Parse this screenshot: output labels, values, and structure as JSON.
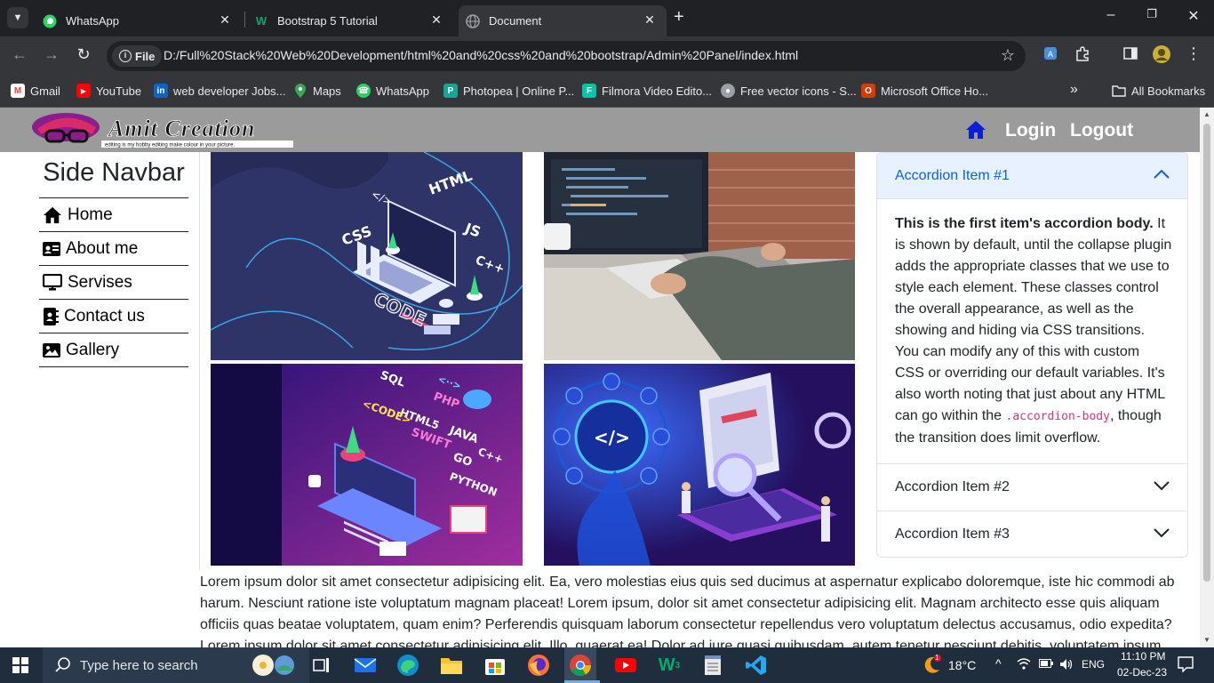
{
  "browser": {
    "tabs": [
      {
        "title": "WhatsApp",
        "active": false
      },
      {
        "title": "Bootstrap 5 Tutorial",
        "active": false
      },
      {
        "title": "Document",
        "active": true
      }
    ],
    "address": {
      "scheme_label": "File",
      "url": "D:/Full%20Stack%20Web%20Development/html%20and%20css%20and%20bootstrap/Admin%20Panel/index.html"
    },
    "bookmarks": [
      {
        "label": "Gmail",
        "icon": "gmail-icon",
        "color": "#ea4335"
      },
      {
        "label": "YouTube",
        "icon": "youtube-icon",
        "color": "#ff0000"
      },
      {
        "label": "web developer Jobs...",
        "icon": "linkedin-icon",
        "color": "#0a66c2"
      },
      {
        "label": "Maps",
        "icon": "maps-icon",
        "color": "#34a853"
      },
      {
        "label": "WhatsApp",
        "icon": "whatsapp-icon",
        "color": "#25d366"
      },
      {
        "label": "Photopea | Online P...",
        "icon": "photopea-icon",
        "color": "#18a497"
      },
      {
        "label": "Filmora Video Edito...",
        "icon": "filmora-icon",
        "color": "#00c6a7"
      },
      {
        "label": "Free vector icons - S...",
        "icon": "globe-icon",
        "color": "#9aa0a6"
      },
      {
        "label": "Microsoft Office Ho...",
        "icon": "office-icon",
        "color": "#d83b01"
      }
    ],
    "all_bookmarks_label": "All Bookmarks"
  },
  "site": {
    "logo_text": "Amit Creation",
    "logo_tagline": "editing is my hobby editing make colour in your picture",
    "nav": {
      "login": "Login",
      "logout": "Logout"
    },
    "sidebar": {
      "title": "Side Navbar",
      "items": [
        {
          "label": "Home",
          "icon": "home-icon"
        },
        {
          "label": "About me",
          "icon": "id-card-icon"
        },
        {
          "label": "Servises",
          "icon": "monitor-icon"
        },
        {
          "label": "Contact us",
          "icon": "contact-book-icon"
        },
        {
          "label": "Gallery",
          "icon": "image-icon"
        }
      ]
    },
    "gallery": {
      "img1": {
        "labels": [
          "HTML",
          "CSS",
          "JS",
          "C++",
          "CODE",
          "</>"
        ]
      },
      "img3": {
        "labels": [
          "SQL",
          "PHP",
          "HTML5",
          "<CODE>",
          "SWIFT",
          "JAVA",
          "GO",
          "C++",
          "PYTHON",
          "<··>"
        ]
      },
      "img4": {
        "labels": [
          "</>"
        ]
      }
    },
    "accordion": {
      "items": [
        {
          "title": "Accordion Item #1",
          "expanded": true
        },
        {
          "title": "Accordion Item #2",
          "expanded": false
        },
        {
          "title": "Accordion Item #3",
          "expanded": false
        }
      ],
      "body_strong": "This is the first item's accordion body.",
      "body_text_1": " It is shown by default, until the collapse plugin adds the appropriate classes that we use to style each element. These classes control the overall appearance, as well as the showing and hiding via CSS transitions. You can modify any of this with custom CSS or overriding our default variables. It's also worth noting that just about any HTML can go within the ",
      "body_code": ".accordion-body",
      "body_text_2": ", though the transition does limit overflow."
    },
    "lorem": "Lorem ipsum dolor sit amet consectetur adipisicing elit. Ea, vero molestias eius quis sed ducimus at aspernatur explicabo doloremque, iste hic commodi ab harum. Nesciunt ratione iste voluptatum magnam placeat! Lorem ipsum, dolor sit amet consectetur adipisicing elit. Magnam architecto esse quis aliquam officiis quas beatae voluptatem, quam enim? Perferendis quisquam laborum consectetur repellendus vero voluptatum delectus accusamus, odio expedita? Lorem ipsum dolor sit amet consectetur adipisicing elit. Illo, quaerat ea! Dolor ad iure quasi quibusdam, autem tenetur nesciunt debitis, voluptatem ipsum."
  },
  "taskbar": {
    "search_placeholder": "Type here to search",
    "weather": "18°C",
    "language": "ENG",
    "time": "11:10 PM",
    "date": "02-Dec-23",
    "weather_badge": "1"
  }
}
